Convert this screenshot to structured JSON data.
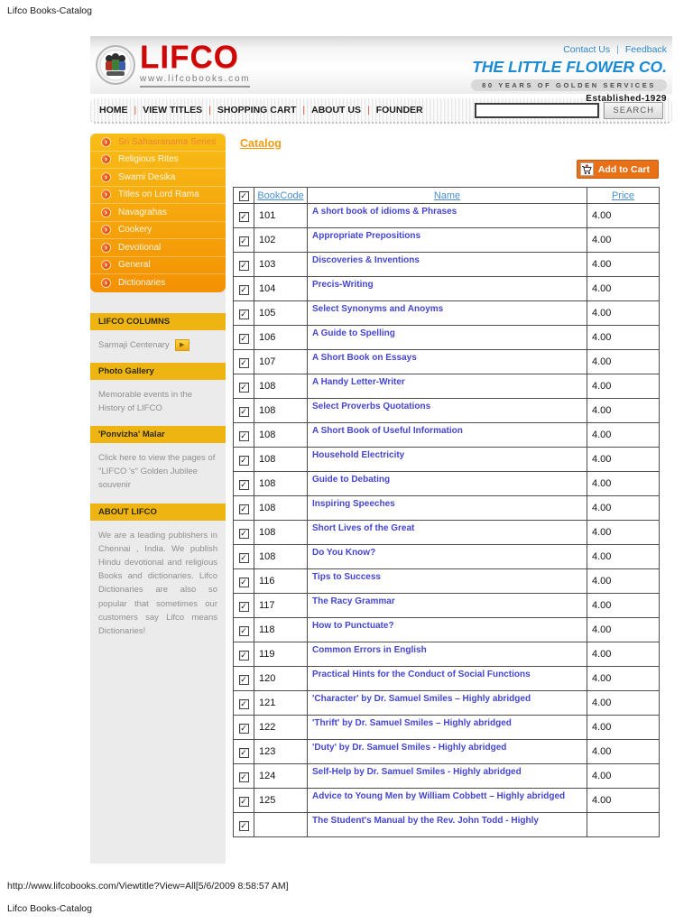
{
  "document": {
    "header_title": "Lifco Books-Catalog",
    "footer_url": "http://www.lifcobooks.com/Viewtitle?View=All[5/6/2009 8:58:57 AM]",
    "footer_title": "Lifco Books-Catalog"
  },
  "masthead": {
    "logo_text": "LIFCO",
    "logo_url": "www.lifcobooks.com",
    "contact_us": "Contact Us",
    "feedback": "Feedback",
    "company_name": "THE LITTLE FLOWER CO.",
    "tagline": "80 YEARS OF GOLDEN SERVICES",
    "established": "Established-1929"
  },
  "navbar": {
    "items": [
      "HOME",
      "VIEW TITLES",
      "SHOPPING CART",
      "ABOUT US",
      "FOUNDER"
    ],
    "search_value": "",
    "search_button": "SEARCH"
  },
  "sidebar": {
    "menu": [
      "Sri Sahasranama Series",
      "Religious Rites",
      "Swami Desika",
      "Titles on Lord Rama",
      "Navagrahas",
      "Cookery",
      "Devotional",
      "General",
      "Dictionaries"
    ],
    "sections": [
      {
        "title": "LIFCO COLUMNS",
        "body": "Sarmaji Centenary",
        "has_play": true,
        "link": true
      },
      {
        "title": "Photo Gallery",
        "body": "Memorable events in the History of LIFCO",
        "has_play": false,
        "link": false
      },
      {
        "title": "'Ponvizha' Malar",
        "body": "Click here to view the pages of \"LIFCO 's\" Golden Jubilee souvenir",
        "has_play": false,
        "link": true
      },
      {
        "title": "ABOUT LIFCO",
        "body": "We are a leading publishers in Chennai , India. We publish Hindu devotional and religious Books and dictionaries. Lifco Dictionaries are also so popular that sometimes our customers say Lifco means Dictionaries!",
        "has_play": false,
        "link": false
      }
    ]
  },
  "catalog": {
    "title": "Catalog",
    "add_to_cart_label": "Add to Cart",
    "columns": [
      "BookCode",
      "Name",
      "Price"
    ],
    "rows": [
      {
        "code": "101",
        "name": "A short book of idioms & Phrases",
        "price": "4.00"
      },
      {
        "code": "102",
        "name": "Appropriate Prepositions",
        "price": "4.00"
      },
      {
        "code": "103",
        "name": "Discoveries & Inventions",
        "price": "4.00"
      },
      {
        "code": "104",
        "name": "Precis-Writing",
        "price": "4.00"
      },
      {
        "code": "105",
        "name": "Select Synonyms and Anoyms",
        "price": "4.00"
      },
      {
        "code": "106",
        "name": "A Guide to Spelling",
        "price": "4.00"
      },
      {
        "code": "107",
        "name": "A Short Book on Essays",
        "price": "4.00"
      },
      {
        "code": "108",
        "name": "A Handy Letter-Writer",
        "price": "4.00"
      },
      {
        "code": "108",
        "name": "Select Proverbs Quotations",
        "price": "4.00"
      },
      {
        "code": "108",
        "name": "A Short Book of Useful Information",
        "price": "4.00"
      },
      {
        "code": "108",
        "name": "Household Electricity",
        "price": "4.00"
      },
      {
        "code": "108",
        "name": "Guide to Debating",
        "price": "4.00"
      },
      {
        "code": "108",
        "name": "Inspiring Speeches",
        "price": "4.00"
      },
      {
        "code": "108",
        "name": "Short Lives of the Great",
        "price": "4.00"
      },
      {
        "code": "108",
        "name": "Do You Know?",
        "price": "4.00"
      },
      {
        "code": "116",
        "name": "Tips to Success",
        "price": "4.00"
      },
      {
        "code": "117",
        "name": "The Racy Grammar",
        "price": "4.00"
      },
      {
        "code": "118",
        "name": "How to Punctuate?",
        "price": "4.00"
      },
      {
        "code": "119",
        "name": "Common Errors in English",
        "price": "4.00"
      },
      {
        "code": "120",
        "name": "Practical Hints for the Conduct of Social Functions",
        "price": "4.00"
      },
      {
        "code": "121",
        "name": "'Character' by Dr. Samuel Smiles – Highly abridged",
        "price": "4.00"
      },
      {
        "code": "122",
        "name": "'Thrift' by Dr. Samuel Smiles – Highly abridged",
        "price": "4.00"
      },
      {
        "code": "123",
        "name": "'Duty' by Dr. Samuel Smiles - Highly abridged",
        "price": "4.00"
      },
      {
        "code": "124",
        "name": "Self-Help by Dr. Samuel Smiles - Highly abridged",
        "price": "4.00"
      },
      {
        "code": "125",
        "name": "Advice to Young Men by William Cobbett – Highly abridged",
        "price": "4.00"
      },
      {
        "code": "",
        "name": "The Student's Manual by the Rev. John Todd - Highly",
        "price": ""
      }
    ]
  },
  "colors": {
    "logo_red": "#cf0606",
    "company_blue": "#1b8ad2",
    "link_blue": "#4a8fd2",
    "book_link_blue": "#4545d0",
    "menu_orange_top": "#f8bd17",
    "menu_orange_bottom": "#f39103",
    "gold_bar": "#eeb512",
    "cart_orange": "#e87117",
    "catalog_orange": "#f59b11"
  },
  "icons": {
    "emblem": "lifco-family-emblem",
    "arrow_bullet": "arrow-bullet-icon",
    "play": "play-icon",
    "cart": "shopping-cart-icon",
    "checkbox": "checkbox-checked"
  }
}
